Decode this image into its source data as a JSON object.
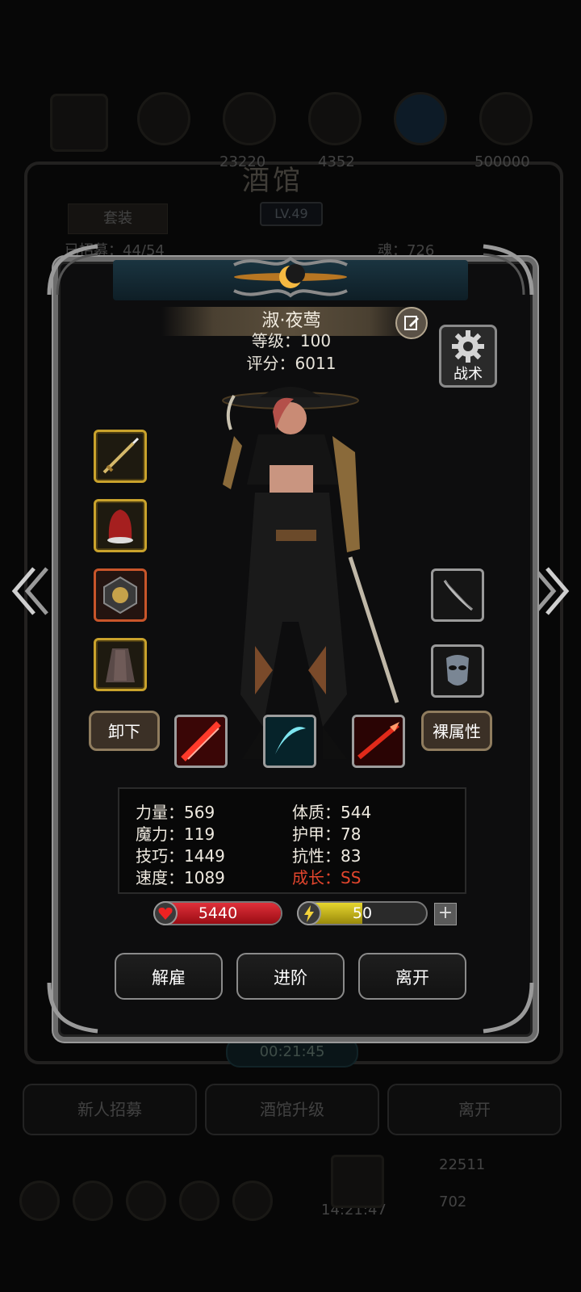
{
  "background": {
    "tavern_title": "酒馆",
    "tavern_level": "LV.49",
    "tab_label": "套装",
    "partial_left": "已招募：44/54",
    "partial_right": "魂：726",
    "top_numbers": [
      "23220",
      "4352",
      "500000"
    ],
    "timer": "00:21:45",
    "buttons": [
      "新人招募",
      "酒馆升级",
      "离开"
    ],
    "bottom_numbers": [
      "22511",
      "702"
    ],
    "clock": "14:21:47"
  },
  "hero": {
    "name": "淑·夜莺",
    "level_line": "等级：100",
    "score_line": "评分：6011",
    "tactics_label": "战术"
  },
  "equipment": {
    "slots": [
      "dagger-icon",
      "hood-icon",
      "amulet-icon",
      "cloak-icon",
      "bow-icon",
      "mask-icon"
    ]
  },
  "actions": {
    "unequip_label": "卸下",
    "naked_stats_label": "裸属性",
    "dismiss_label": "解雇",
    "advance_label": "进阶",
    "leave_label": "离开"
  },
  "skills": [
    "red-slash-icon",
    "cyan-crescent-icon",
    "red-spear-icon"
  ],
  "stats": {
    "strength": "力量：569",
    "magic": "魔力：119",
    "skill": "技巧：1449",
    "speed": "速度：1089",
    "constitution": "体质：544",
    "armor": "护甲：78",
    "resistance": "抗性：83",
    "growth": "成长：SS"
  },
  "bars": {
    "hp_value": "5440",
    "hp_fill": 1.0,
    "energy_value": "50",
    "energy_fill": 0.5,
    "plus_symbol": "+"
  },
  "colors": {
    "growth": "#e2452d",
    "hp": "#c4141c",
    "energy": "#d6c21a",
    "frame": "#6b6b6b"
  }
}
